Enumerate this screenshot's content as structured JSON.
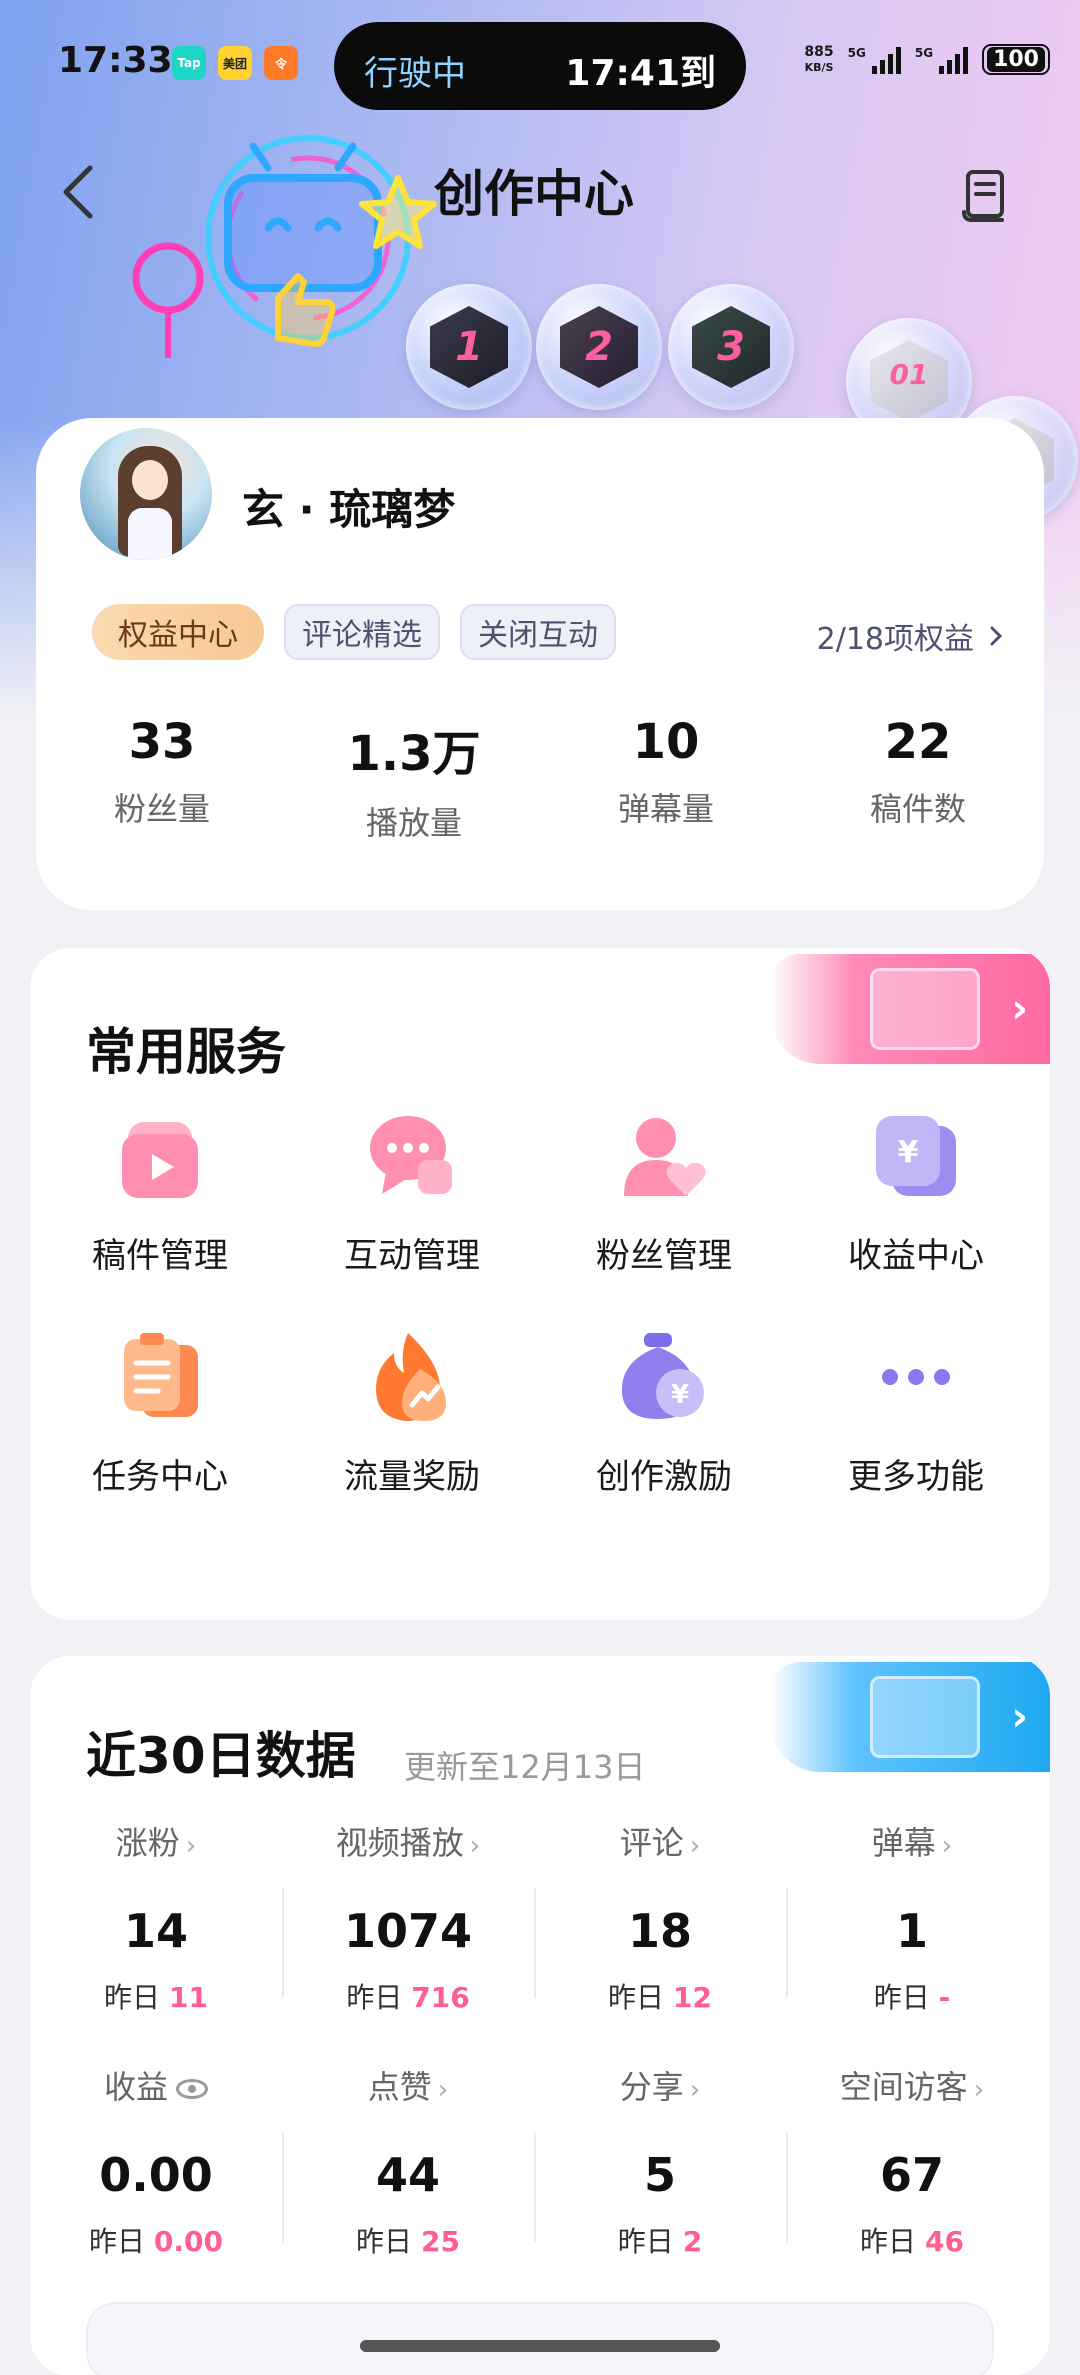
{
  "status_bar": {
    "time": "17:33",
    "apps": [
      "Tap",
      "美团",
      "令"
    ],
    "nav_pill_left": "行驶中",
    "nav_pill_right": "17:41到",
    "net_speed": "885",
    "net_unit": "KB/S",
    "signal_labels": [
      "5G",
      "5G"
    ],
    "battery": "100"
  },
  "header": {
    "title": "创作中心",
    "back_icon": "chevron-left-icon",
    "doc_icon": "document-icon"
  },
  "profile": {
    "username": "玄 · 琉璃梦",
    "tags": [
      "权益中心",
      "评论精选",
      "关闭互动"
    ],
    "rights_text": "2/18项权益",
    "stats": [
      {
        "value": "33",
        "label": "粉丝量"
      },
      {
        "value": "1.3万",
        "label": "播放量"
      },
      {
        "value": "10",
        "label": "弹幕量"
      },
      {
        "value": "22",
        "label": "稿件数"
      }
    ]
  },
  "services": {
    "title": "常用服务",
    "items": [
      {
        "label": "稿件管理",
        "icon": "video-file-icon"
      },
      {
        "label": "互动管理",
        "icon": "chat-bubble-icon"
      },
      {
        "label": "粉丝管理",
        "icon": "fans-heart-icon"
      },
      {
        "label": "收益中心",
        "icon": "yen-card-icon"
      },
      {
        "label": "任务中心",
        "icon": "clipboard-icon"
      },
      {
        "label": "流量奖励",
        "icon": "flame-icon"
      },
      {
        "label": "创作激励",
        "icon": "money-bag-icon"
      },
      {
        "label": "更多功能",
        "icon": "more-dots-icon"
      }
    ]
  },
  "data_30d": {
    "title": "近30日数据",
    "update_text": "更新至12月13日",
    "yesterday_label": "昨日",
    "row1": [
      {
        "label": "涨粉",
        "value": "14",
        "yesterday": "11"
      },
      {
        "label": "视频播放",
        "value": "1074",
        "yesterday": "716"
      },
      {
        "label": "评论",
        "value": "18",
        "yesterday": "12"
      },
      {
        "label": "弹幕",
        "value": "1",
        "yesterday": "-"
      }
    ],
    "row2": [
      {
        "label": "收益",
        "value": "0.00",
        "yesterday": "0.00"
      },
      {
        "label": "点赞",
        "value": "44",
        "yesterday": "25"
      },
      {
        "label": "分享",
        "value": "5",
        "yesterday": "2"
      },
      {
        "label": "空间访客",
        "value": "67",
        "yesterday": "46"
      }
    ]
  },
  "colors": {
    "accent_pink": "#ff5f8f",
    "ribbon_pink": "#ff6aa0",
    "ribbon_blue": "#1ea8f0",
    "gold_tag": "#f6c893"
  }
}
